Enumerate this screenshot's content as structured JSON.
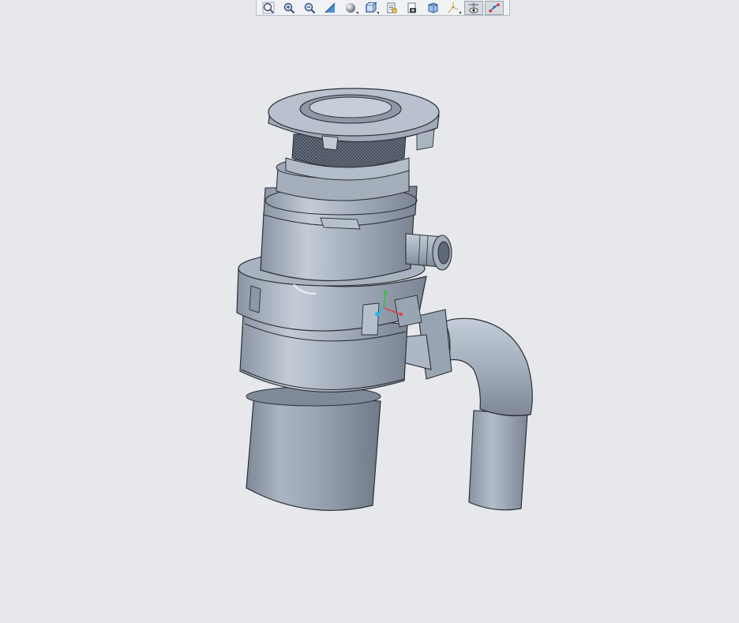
{
  "app": {
    "view_background": "#e6e8ec",
    "model_color": "#9ba6b5"
  },
  "view_toolbar": {
    "buttons": [
      {
        "name": "refit-icon",
        "active": false
      },
      {
        "name": "zoom-in-icon",
        "active": false
      },
      {
        "name": "zoom-out-icon",
        "active": false
      },
      {
        "name": "repaint-icon",
        "active": false
      },
      {
        "name": "display-style-icon",
        "active": false
      },
      {
        "name": "saved-orientations-icon",
        "active": false
      },
      {
        "name": "view-manager-icon",
        "active": false
      },
      {
        "name": "perspective-icon",
        "active": false
      },
      {
        "name": "section-view-icon",
        "active": false
      },
      {
        "name": "datum-display-icon",
        "active": false
      },
      {
        "name": "annotation-display-icon",
        "active": true
      },
      {
        "name": "spin-center-icon",
        "active": true
      }
    ]
  },
  "scene": {
    "object": "garbage-disposer-3d-model",
    "triad_axes": [
      "x-axis",
      "y-axis",
      "z-axis"
    ]
  }
}
